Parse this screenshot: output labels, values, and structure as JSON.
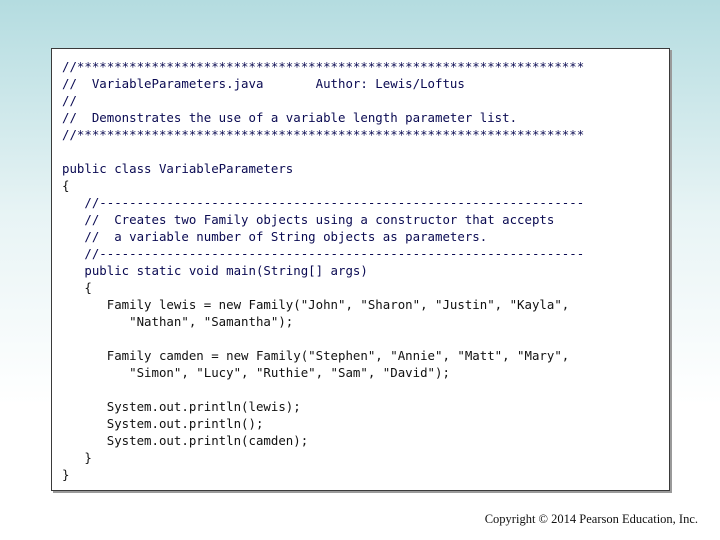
{
  "code": {
    "lines": [
      "//********************************************************************",
      "//  VariableParameters.java       Author: Lewis/Loftus",
      "//",
      "//  Demonstrates the use of a variable length parameter list.",
      "//********************************************************************",
      "",
      "public class VariableParameters",
      "{",
      "   //-----------------------------------------------------------------",
      "   //  Creates two Family objects using a constructor that accepts",
      "   //  a variable number of String objects as parameters.",
      "   //-----------------------------------------------------------------",
      "   public static void main(String[] args)",
      "   {",
      "      Family lewis = new Family(\"John\", \"Sharon\", \"Justin\", \"Kayla\",",
      "         \"Nathan\", \"Samantha\");",
      "",
      "      Family camden = new Family(\"Stephen\", \"Annie\", \"Matt\", \"Mary\",",
      "         \"Simon\", \"Lucy\", \"Ruthie\", \"Sam\", \"David\");",
      "",
      "      System.out.println(lewis);",
      "      System.out.println();",
      "      System.out.println(camden);",
      "   }",
      "}"
    ]
  },
  "footer": {
    "copyright": "Copyright © 2014 Pearson Education, Inc."
  }
}
